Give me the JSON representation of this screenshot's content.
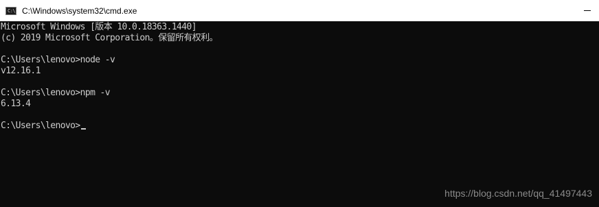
{
  "window": {
    "title": "C:\\Windows\\system32\\cmd.exe",
    "icon": "cmd-console-icon",
    "icon_glyph": "C:\\"
  },
  "console": {
    "lines": [
      "Microsoft Windows [版本 10.0.18363.1440]",
      "(c) 2019 Microsoft Corporation。保留所有权利。",
      "",
      "C:\\Users\\lenovo>node -v",
      "v12.16.1",
      "",
      "C:\\Users\\lenovo>npm -v",
      "6.13.4",
      "",
      "C:\\Users\\lenovo>"
    ]
  },
  "colors": {
    "console_background": "#0c0c0c",
    "console_text": "#cccccc",
    "titlebar_background": "#ffffff",
    "watermark": "#8a8a8a"
  },
  "watermark": {
    "text": "https://blog.csdn.net/qq_41497443"
  }
}
